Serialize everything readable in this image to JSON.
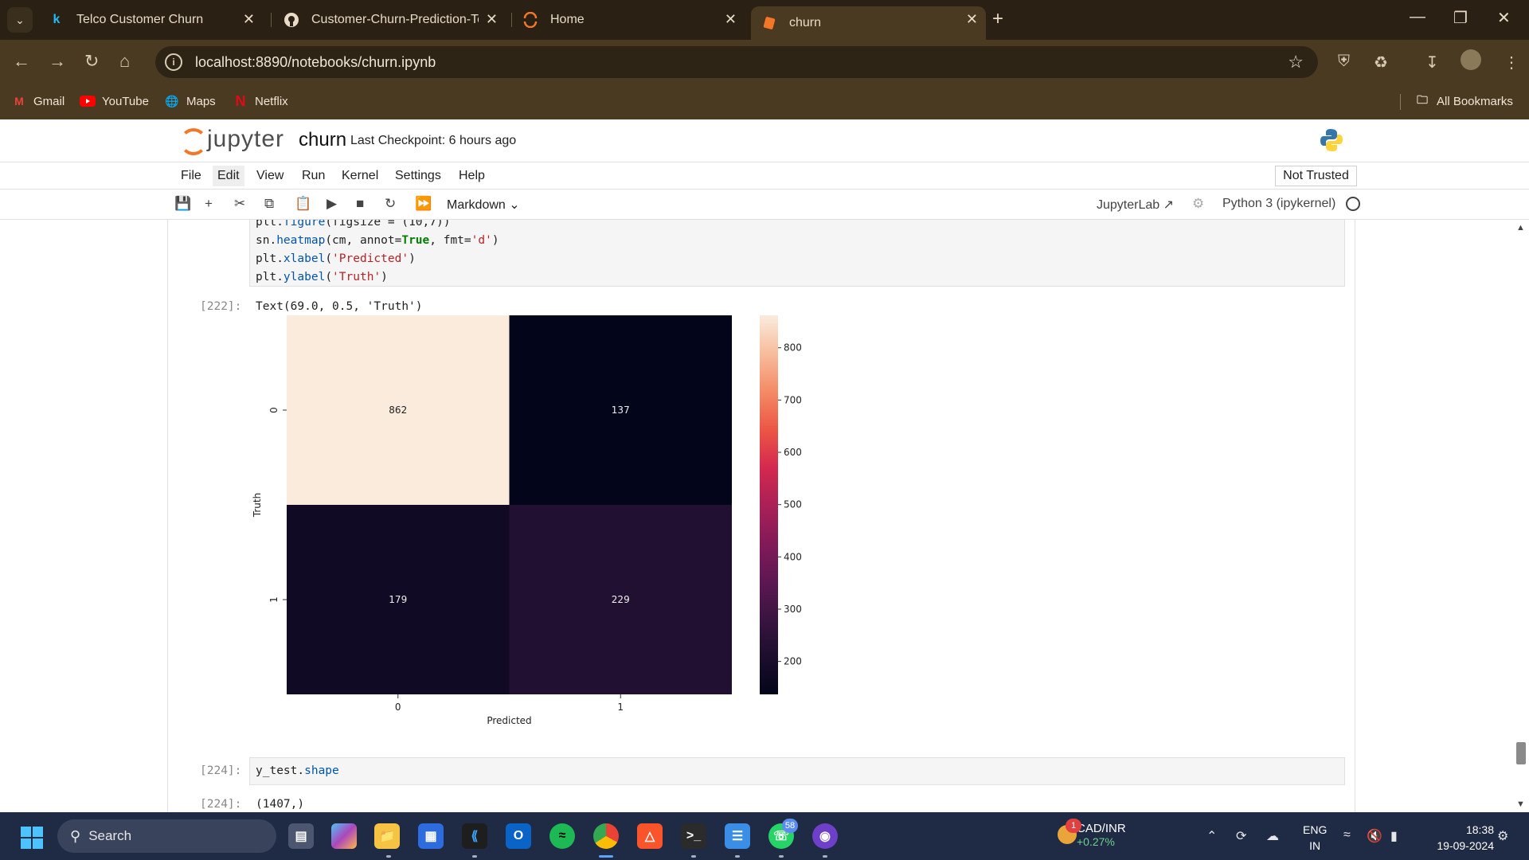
{
  "browser": {
    "tabs": [
      {
        "title": "Telco Customer Churn",
        "icon": "kaggle-icon"
      },
      {
        "title": "Customer-Churn-Prediction-Te",
        "icon": "github-icon"
      },
      {
        "title": "Home",
        "icon": "jupyter-icon"
      },
      {
        "title": "churn",
        "icon": "notebook-icon",
        "active": true
      }
    ],
    "url": "localhost:8890/notebooks/churn.ipynb",
    "bookmarks": [
      "Gmail",
      "YouTube",
      "Maps",
      "Netflix"
    ],
    "all_bookmarks": "All Bookmarks"
  },
  "jupyter": {
    "logo_text": "jupyter",
    "notebook_name": "churn",
    "checkpoint": "Last Checkpoint: 6 hours ago",
    "menu": [
      "File",
      "Edit",
      "View",
      "Run",
      "Kernel",
      "Settings",
      "Help"
    ],
    "trust": "Not Trusted",
    "cell_type": "Markdown",
    "jupyterlab_link": "JupyterLab",
    "kernel": "Python 3 (ipykernel)"
  },
  "cells": {
    "code_lines": [
      "plt.figure(figsize = (10,7))",
      "sn.heatmap(cm, annot=True, fmt='d')",
      "plt.xlabel('Predicted')",
      "plt.ylabel('Truth')"
    ],
    "prompt_222": "[222]:",
    "output_222": "Text(69.0, 0.5, 'Truth')",
    "prompt_224_in": "[224]:",
    "code_224": "y_test.shape",
    "prompt_224_out": "[224]:",
    "output_224": "(1407,)"
  },
  "chart_data": {
    "type": "heatmap",
    "x_categories": [
      "0",
      "1"
    ],
    "y_categories": [
      "0",
      "1"
    ],
    "values": [
      [
        862,
        137
      ],
      [
        179,
        229
      ]
    ],
    "xlabel": "Predicted",
    "ylabel": "Truth",
    "colorbar_ticks": [
      200,
      300,
      400,
      500,
      600,
      700,
      800
    ],
    "colorbar_range": [
      137,
      862
    ],
    "colormap": "rocket"
  },
  "taskbar": {
    "search": "Search",
    "fx_pair": "CAD/INR",
    "fx_change": "+0.27%",
    "fx_badge": "1",
    "whatsapp_badge": "58",
    "lang_top": "ENG",
    "lang_bottom": "IN",
    "time": "18:38",
    "date": "19-09-2024"
  }
}
